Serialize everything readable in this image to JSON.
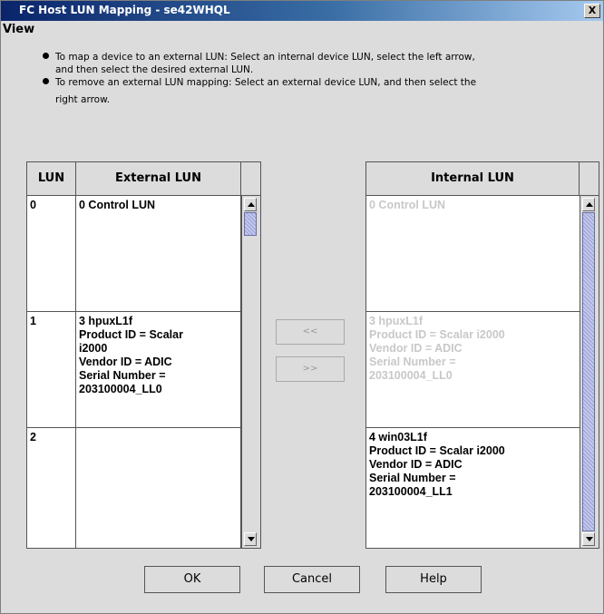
{
  "window": {
    "title": "FC Host LUN Mapping - se42WHQL",
    "close_label": "X"
  },
  "menu": {
    "view_label": "View"
  },
  "instructions": [
    {
      "line1": "To map a device to an external LUN: Select an internal device LUN, select the left arrow,",
      "line2": "and then select the desired external LUN."
    },
    {
      "line1": "To remove an external LUN mapping: Select an external device LUN, and then select the",
      "line2": "right arrow."
    }
  ],
  "external_table": {
    "headers": [
      "LUN",
      "External LUN"
    ],
    "rows": [
      {
        "lun": "0",
        "value": "0 Control LUN"
      },
      {
        "lun": "1",
        "value": "3  hpuxL1f\nProduct ID = Scalar\ni2000\nVendor ID = ADIC\nSerial Number =\n203100004_LL0"
      },
      {
        "lun": "2",
        "value": ""
      }
    ]
  },
  "internal_table": {
    "header": "Internal LUN",
    "rows": [
      {
        "value": "0 Control LUN",
        "disabled": true
      },
      {
        "value": "3  hpuxL1f\nProduct ID = Scalar i2000\nVendor ID = ADIC\nSerial Number =\n203100004_LL0",
        "disabled": true
      },
      {
        "value": "4  win03L1f\nProduct ID = Scalar i2000\nVendor ID = ADIC\nSerial Number =\n203100004_LL1",
        "disabled": false
      }
    ]
  },
  "arrows": {
    "left_label": "<<",
    "right_label": ">>"
  },
  "buttons": {
    "ok": "OK",
    "cancel": "Cancel",
    "help": "Help"
  }
}
